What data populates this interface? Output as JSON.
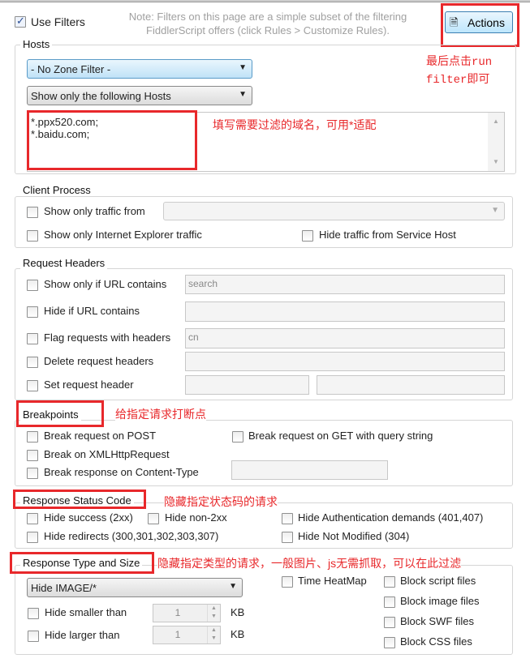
{
  "use_filters": {
    "label": "Use Filters",
    "checked": true
  },
  "note": {
    "line1": "Note: Filters on this page are a simple subset of the filtering",
    "line2": "FiddlerScript offers (click Rules > Customize Rules)."
  },
  "actions_button": "Actions",
  "hosts": {
    "title": "Hosts",
    "zone_filter": "- No Zone Filter -",
    "host_filter": "Show only the following Hosts",
    "host_list": "*.ppx520.com;\n*.baidu.com;"
  },
  "client_process": {
    "title": "Client Process",
    "show_only_traffic_from": "Show only traffic from",
    "show_only_ie": "Show only Internet Explorer traffic",
    "hide_service_host": "Hide traffic from Service Host"
  },
  "request_headers": {
    "title": "Request Headers",
    "url_contains": "Show only if URL contains",
    "url_contains_value": "search",
    "hide_url": "Hide if URL contains",
    "flag_headers": "Flag requests with headers",
    "flag_headers_value": "cn",
    "delete_headers": "Delete request headers",
    "set_header": "Set request header"
  },
  "breakpoints": {
    "title": "Breakpoints",
    "post": "Break request on POST",
    "get_query": "Break request on GET with query string",
    "xhr": "Break on XMLHttpRequest",
    "content_type": "Break response on Content-Type"
  },
  "status_code": {
    "title": "Response Status Code",
    "success": "Hide success (2xx)",
    "non2xx": "Hide non-2xx",
    "auth": "Hide Authentication demands (401,407)",
    "redirects": "Hide redirects (300,301,302,303,307)",
    "not_modified": "Hide Not Modified (304)"
  },
  "type_size": {
    "title": "Response Type and Size",
    "type_filter": "Hide IMAGE/*",
    "smaller": "Hide smaller than",
    "smaller_value": "1",
    "larger": "Hide larger than",
    "larger_value": "1",
    "unit": "KB",
    "heatmap": "Time HeatMap",
    "block_script": "Block script files",
    "block_image": "Block image files",
    "block_swf": "Block SWF files",
    "block_css": "Block CSS files"
  },
  "annotations": {
    "run_line1": "最后点击run",
    "run_line2": "filter即可",
    "hosts": "填写需要过滤的域名，可用*适配",
    "breakpoints": "给指定请求打断点",
    "status": "隐藏指定状态码的请求",
    "type": "隐藏指定类型的请求，一般图片、js无需抓取，可以在此过滤"
  },
  "colors": {
    "annotation": "#e8282b"
  }
}
